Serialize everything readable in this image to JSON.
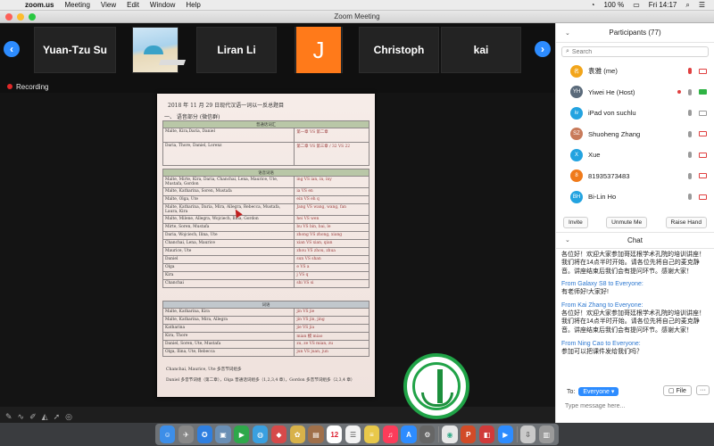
{
  "menubar": {
    "app": "zoom.us",
    "items": [
      "Meeting",
      "View",
      "Edit",
      "Window",
      "Help"
    ],
    "battery": "100 %",
    "clock": "Fri 14:17"
  },
  "window": {
    "title": "Zoom Meeting"
  },
  "strip": {
    "tiles": [
      {
        "label": "Yuan-Tzu Su"
      },
      {
        "label": ""
      },
      {
        "label": "Liran Li"
      },
      {
        "label": "J"
      },
      {
        "label": "Christoph"
      },
      {
        "label": "kai"
      }
    ]
  },
  "recording": {
    "label": "Recording"
  },
  "document": {
    "header": "2018 年 11 月 29 日现代汉语一词以一反总题目",
    "subheader": "一、 语音部分 (微信群)",
    "section1": "普通话词汇",
    "section2": "语音词语",
    "section3": "词语",
    "rows_top": [
      {
        "names": "Malte, Kira,Daria, Daniel",
        "value": "第一章 VS 第二章"
      },
      {
        "names": "Daria, Thore, Daniel, Lorenz",
        "value": "第二章 VS 第三章 / 32 VS 22"
      }
    ],
    "rows_mid": [
      {
        "names": "Malte, Mirte, Kira, Daria, Chanchai, Lena, Maurice, Ute, Mustafa, Gordon",
        "value": "ing VS ian, in, iny"
      },
      {
        "names": "Malte, Katharina, Soren, Mustafa",
        "value": "ia VS en"
      },
      {
        "names": "Malte, Olga, Ute",
        "value": "ein VS eh q"
      },
      {
        "names": "Malte, Katharina, Daria, Mira, Allegra, Rebecca, Mustafa, Laura, Kira",
        "value": "Jang VS wang, wang, fan"
      },
      {
        "names": "Malte, Milene, Allegra, Wojciech, Ilina, Gordon",
        "value": "hei VS wen"
      },
      {
        "names": "Mirte, Soren, Mustafa",
        "value": "bu VS bin, bai, le"
      },
      {
        "names": "Daria, Wojciech, Ilina, Ute",
        "value": "zhong VS zhong, xiang"
      },
      {
        "names": "Chanchai, Lena, Maurice",
        "value": "xian VS xian, qian"
      },
      {
        "names": "Maurice, Ute",
        "value": "zhou VS zhou, zhua"
      },
      {
        "names": "Daniel",
        "value": "sun VS shan"
      },
      {
        "names": "Olga",
        "value": "e VS a"
      },
      {
        "names": "Kira",
        "value": "j VS q"
      },
      {
        "names": "Chanchai",
        "value": "shi VS si"
      }
    ],
    "rows_bottom": [
      {
        "names": "Malte, Katharina, Kira",
        "value": "jin VS jie"
      },
      {
        "names": "Malte, Katharina, Mira, Allegra",
        "value": "jin VS jin, jing"
      },
      {
        "names": "Katharina",
        "value": "jie VS jia"
      },
      {
        "names": "Kira, Thore",
        "value": "mian 模 miao"
      },
      {
        "names": "Daniel, Soren, Ute, Mustafa",
        "value": "zu, ze VS mian, zu"
      },
      {
        "names": "Olga, Ilina, Ute, Rebecca",
        "value": "jun VS juan, jun"
      }
    ],
    "foot1": "Chanchai, Maurice, Ute 多音节词组多",
    "foot2": "Daniel 多音节词组（第二章），Olga 普通话词组多（1,2,3,4 章），Gordon 多音节词组多（2,3,4 章）"
  },
  "participants": {
    "title": "Participants (77)",
    "search_placeholder": "Search",
    "list": [
      {
        "initials": "名",
        "name": "袁雅 (me)",
        "color": "#f2a51a"
      },
      {
        "initials": "YH",
        "name": "Yiwei He (Host)",
        "color": "#5a6a7a"
      },
      {
        "initials": "iv",
        "name": "iPad von suchlu",
        "color": "#23a3e0"
      },
      {
        "initials": "SZ",
        "name": "Shuoheng Zhang",
        "color": "#c87a5a"
      },
      {
        "initials": "X",
        "name": "Xue",
        "color": "#23a3e0"
      },
      {
        "initials": "8",
        "name": "81935373483",
        "color": "#f07a1a"
      },
      {
        "initials": "BH",
        "name": "Bi-Lin Ho",
        "color": "#23a3e0"
      }
    ],
    "buttons": {
      "invite": "Invite",
      "unmute": "Unmute Me",
      "raise": "Raise Hand"
    }
  },
  "chat": {
    "title": "Chat",
    "messages": [
      {
        "from": "",
        "text": "各位好！欢迎大家参加哥廷根学术孔院的培训讲座！我们将在14点半时开始。请各位先将自己的麦克静音。讲座结束后我们会有提问环节。感谢大家！"
      },
      {
        "from": "From Galaxy S8 to Everyone:",
        "text": "有老师好!大家好!"
      },
      {
        "from": "From Kai Zhang to Everyone:",
        "text": "各位好！欢迎大家参加哥廷根学术孔院的培训讲座！我们将在14点半时开始。请各位先将自己的麦克静音。讲座结束后我们会有提问环节。感谢大家！"
      },
      {
        "from": "From Ning Cao to Everyone:",
        "text": "参加可以把课件发给我们吗？"
      }
    ],
    "to_label": "To:",
    "recipient": "Everyone",
    "file_label": "File",
    "more_label": "···",
    "input_placeholder": "Type message here..."
  }
}
